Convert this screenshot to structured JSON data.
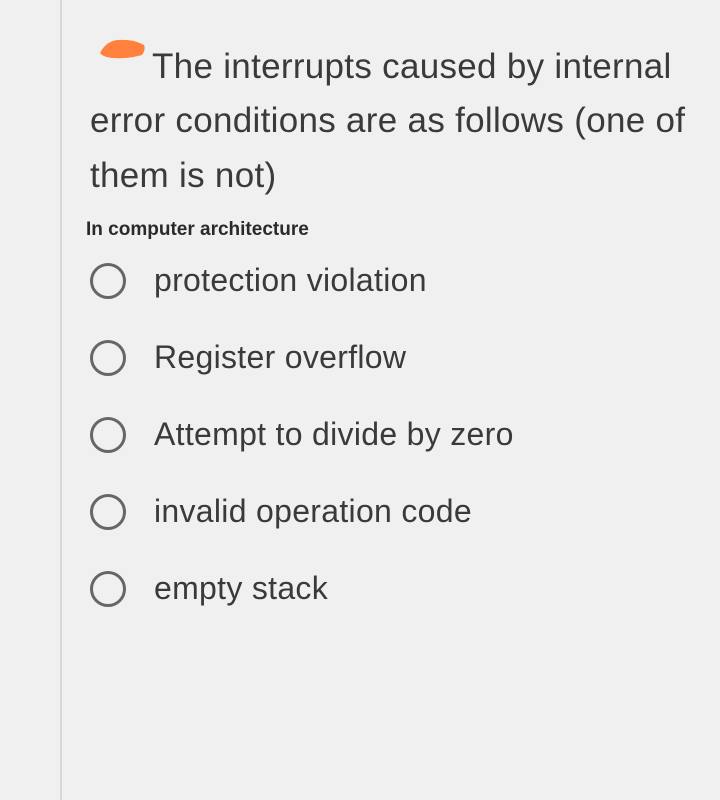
{
  "question": {
    "text": "The interrupts caused by internal error conditions are as follows (one of them is not)",
    "subject": "In computer architecture"
  },
  "options": [
    {
      "label": "protection violation"
    },
    {
      "label": "Register overflow"
    },
    {
      "label": "Attempt to divide by zero"
    },
    {
      "label": "invalid operation code"
    },
    {
      "label": "empty stack"
    }
  ]
}
